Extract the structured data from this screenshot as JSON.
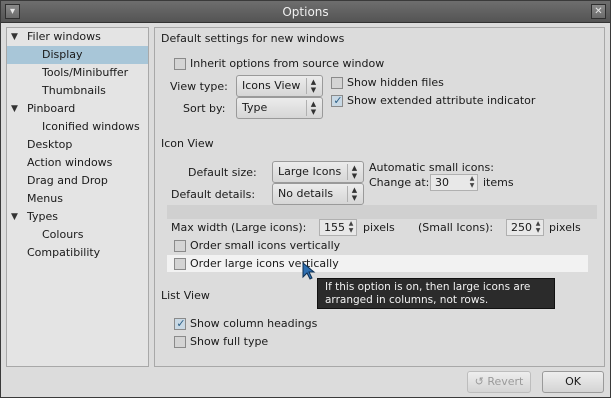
{
  "window": {
    "title": "Options"
  },
  "sidebar": {
    "items": [
      {
        "label": "Filer windows",
        "arrow": "▼",
        "selected": false
      },
      {
        "label": "Display",
        "arrow": "",
        "selected": true
      },
      {
        "label": "Tools/Minibuffer",
        "arrow": "",
        "selected": false
      },
      {
        "label": "Thumbnails",
        "arrow": "",
        "selected": false
      },
      {
        "label": "Pinboard",
        "arrow": "▼",
        "selected": false
      },
      {
        "label": "Iconified windows",
        "arrow": "",
        "selected": false
      },
      {
        "label": "Desktop",
        "arrow": "",
        "selected": false
      },
      {
        "label": "Action windows",
        "arrow": "",
        "selected": false
      },
      {
        "label": "Drag and Drop",
        "arrow": "",
        "selected": false
      },
      {
        "label": "Menus",
        "arrow": "",
        "selected": false
      },
      {
        "label": "Types",
        "arrow": "▼",
        "selected": false
      },
      {
        "label": "Colours",
        "arrow": "",
        "selected": false
      },
      {
        "label": "Compatibility",
        "arrow": "",
        "selected": false
      }
    ]
  },
  "main": {
    "defaults_title": "Default settings for new windows",
    "inherit_label": "Inherit options from source window",
    "inherit_checked": false,
    "view_type_label": "View type:",
    "view_type_value": "Icons View",
    "sort_by_label": "Sort by:",
    "sort_by_value": "Type",
    "show_hidden_label": "Show hidden files",
    "show_hidden_checked": false,
    "show_xattr_label": "Show extended attribute indicator",
    "show_xattr_checked": true,
    "icon_view_title": "Icon View",
    "default_size_label": "Default size:",
    "default_size_value": "Large Icons",
    "auto_small_label": "Automatic small icons:",
    "change_at_label": "Change at:",
    "change_at_value": "30",
    "items_label": "items",
    "default_details_label": "Default details:",
    "default_details_value": "No details",
    "max_width_large_label": "Max width (Large icons):",
    "max_width_large_value": "155",
    "pixels_label": "pixels",
    "small_icons_label": "(Small Icons):",
    "max_width_small_value": "250",
    "order_small_label": "Order small icons vertically",
    "order_small_checked": false,
    "order_large_label": "Order large icons vertically",
    "order_large_checked": false,
    "tooltip": "If this option is on, then large icons are arranged in columns, not rows.",
    "list_view_title": "List View",
    "show_headings_label": "Show column headings",
    "show_headings_checked": true,
    "show_full_type_label": "Show full type",
    "show_full_type_checked": false
  },
  "buttons": {
    "revert_label": "Revert",
    "ok_label": "OK"
  },
  "colors": {
    "selection": "#a8c6d8",
    "checkmark": "#2b5f86",
    "titlebar": "#5e5e5e",
    "tooltip_bg": "#2b2b2b",
    "cursor": "#2f6fb0"
  }
}
